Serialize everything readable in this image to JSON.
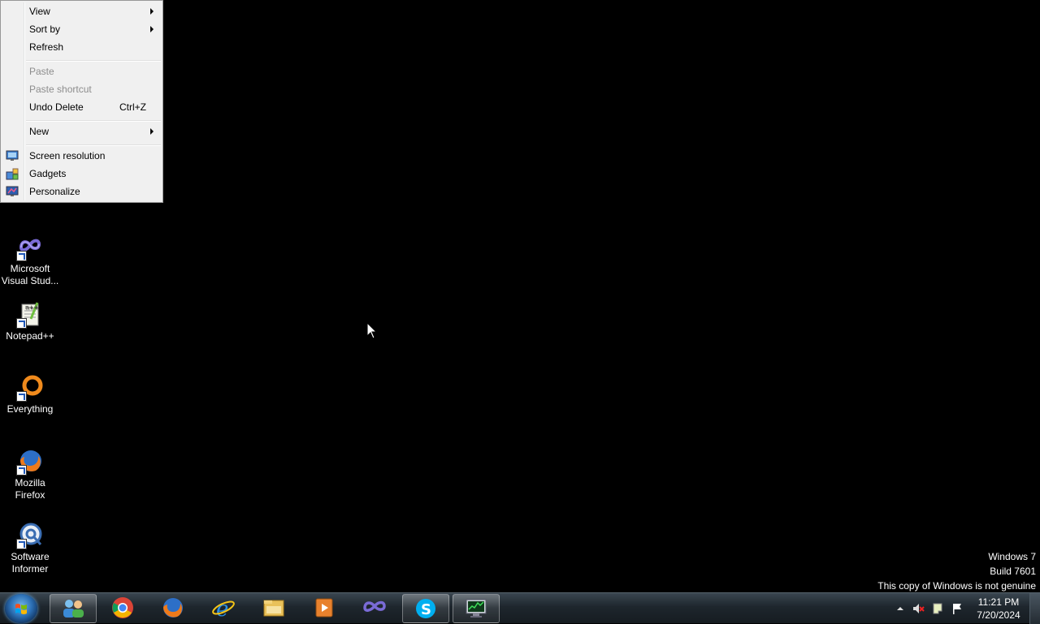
{
  "context_menu": {
    "items": [
      {
        "label": "View",
        "has_submenu": true,
        "enabled": true
      },
      {
        "label": "Sort by",
        "has_submenu": true,
        "enabled": true
      },
      {
        "label": "Refresh",
        "enabled": true
      },
      {
        "label": "Paste",
        "enabled": false
      },
      {
        "label": "Paste shortcut",
        "enabled": false
      },
      {
        "label": "Undo Delete",
        "shortcut": "Ctrl+Z",
        "enabled": true
      },
      {
        "label": "New",
        "has_submenu": true,
        "enabled": true
      },
      {
        "label": "Screen resolution",
        "icon": "monitor-icon",
        "enabled": true
      },
      {
        "label": "Gadgets",
        "icon": "gadgets-icon",
        "enabled": true
      },
      {
        "label": "Personalize",
        "icon": "personalize-icon",
        "enabled": true
      }
    ]
  },
  "desktop_icons": [
    {
      "label": "Microsoft Visual Stud...",
      "icon": "visual-studio-icon"
    },
    {
      "label": "Notepad++",
      "icon": "notepadpp-icon"
    },
    {
      "label": "Everything",
      "icon": "everything-icon"
    },
    {
      "label": "Mozilla Firefox",
      "icon": "firefox-icon"
    },
    {
      "label": "Software Informer",
      "icon": "software-informer-icon"
    }
  ],
  "watermark": {
    "line1": "Windows 7",
    "line2": "Build 7601",
    "line3": "This copy of Windows is not genuine"
  },
  "taskbar": {
    "pinned": [
      {
        "name": "users-icon",
        "active": true
      },
      {
        "name": "chrome-icon",
        "active": false
      },
      {
        "name": "firefox-icon",
        "active": false
      },
      {
        "name": "internet-explorer-icon",
        "active": false
      },
      {
        "name": "file-explorer-icon",
        "active": false
      },
      {
        "name": "media-player-icon",
        "active": false
      },
      {
        "name": "visual-studio-icon",
        "active": false
      },
      {
        "name": "skype-icon",
        "active": true
      },
      {
        "name": "task-manager-icon",
        "active": true
      }
    ],
    "clock": {
      "time": "11:21 PM",
      "date": "7/20/2024"
    }
  },
  "colors": {
    "menu_bg": "#f0f0f0",
    "disabled_text": "#8d8d8d",
    "desktop_bg": "#000000"
  }
}
